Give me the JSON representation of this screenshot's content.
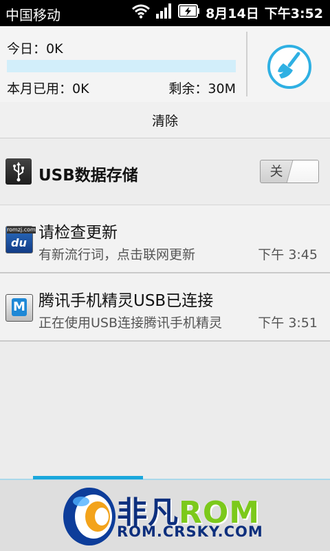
{
  "status_bar": {
    "carrier": "中国移动",
    "date": "8月14日",
    "time": "下午3:52",
    "icons": [
      "wifi-icon",
      "signal-icon",
      "battery-charging-icon"
    ]
  },
  "traffic": {
    "today_label": "今日：0K",
    "month_label": "本月已用：0K",
    "remaining_label": "剩余：30M",
    "usage_fraction": 0.0,
    "clean_icon": "broom-icon"
  },
  "clear_button_label": "清除",
  "usb_storage": {
    "label": "USB数据存储",
    "toggle_label": "关",
    "icon": "usb-icon"
  },
  "notifications": [
    {
      "title": "请检查更新",
      "text": "有新流行词，点击联网更新",
      "time": "下午 3:45",
      "icon": "baidu-input-icon",
      "icon_text": "du",
      "icon_small_text": "romzj.com"
    },
    {
      "title": "腾讯手机精灵USB已连接",
      "text": "正在使用USB连接腾讯手机精灵",
      "time": "下午 3:51",
      "icon": "tencent-phone-assistant-icon",
      "icon_text": "M"
    }
  ],
  "watermark": {
    "line1_a": "非凡",
    "line1_b": "ROM",
    "line2": "ROM.CRSKY.COM"
  },
  "colors": {
    "accent": "#1aa7dc",
    "usage_bar": "#d2eefa",
    "status_bar": "#000000"
  }
}
